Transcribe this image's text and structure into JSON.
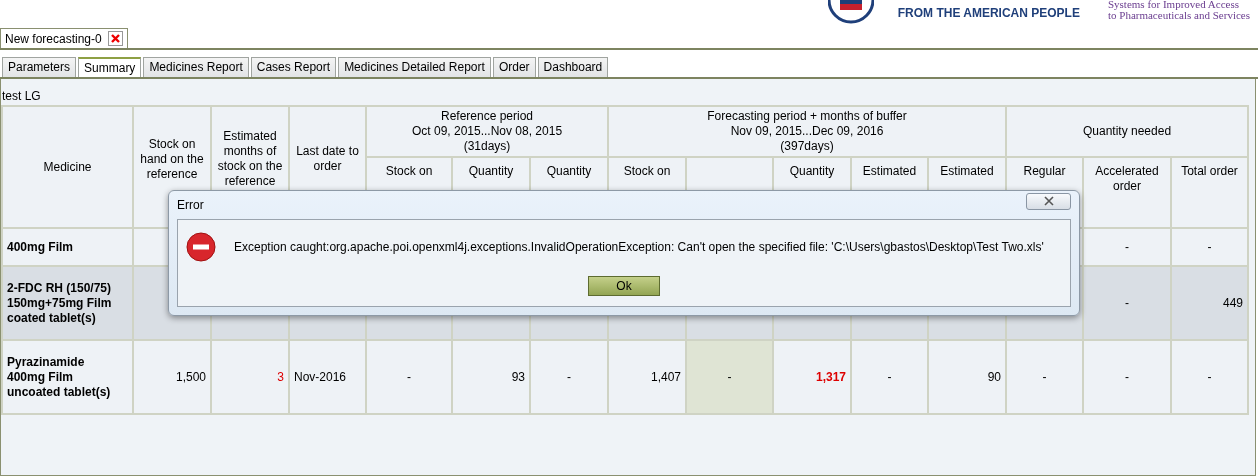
{
  "logo": {
    "tagline": "FROM THE AMERICAN PEOPLE",
    "program_lines": [
      "Systems for Improved Access",
      "to Pharmaceuticals and Services"
    ]
  },
  "document_tabs": [
    {
      "label": "New forecasting-0",
      "selected": true
    }
  ],
  "tabs": [
    {
      "label": "Parameters",
      "selected": false
    },
    {
      "label": "Summary",
      "selected": true
    },
    {
      "label": "Medicines Report",
      "selected": false
    },
    {
      "label": "Cases Report",
      "selected": false
    },
    {
      "label": "Medicines Detailed Report",
      "selected": false
    },
    {
      "label": "Order",
      "selected": false
    },
    {
      "label": "Dashboard",
      "selected": false
    }
  ],
  "report_title": "test LG",
  "table": {
    "columns": [
      {
        "label": "Medicine"
      },
      {
        "label": "Stock on hand on the reference"
      },
      {
        "label": "Estimated months of stock on the reference"
      },
      {
        "label": "Last date to order"
      },
      {
        "label": "Reference period\nOct 09, 2015...Nov 08, 2015\n(31days)",
        "colspan": 3,
        "children": [
          {
            "kind": "label",
            "label": "Stock on"
          },
          {
            "kind": "label",
            "label": "Quantity"
          },
          {
            "kind": "label",
            "label": "Quantity"
          }
        ]
      },
      {
        "label": "Forecasting period + months of buffer\nNov 09, 2015...Dec 09, 2016\n(397days)",
        "colspan": 5,
        "children": [
          {
            "kind": "label",
            "label": "Stock on"
          },
          {
            "kind": "blank"
          },
          {
            "kind": "label",
            "label": "Quantity"
          },
          {
            "kind": "label",
            "label": "Estimated"
          },
          {
            "kind": "label",
            "label": "Estimated"
          }
        ]
      },
      {
        "label": "Quantity needed",
        "colspan": 3,
        "children": [
          {
            "kind": "label",
            "label": "Regular"
          },
          {
            "kind": "label",
            "label": "Accelerated order"
          },
          {
            "kind": "label",
            "label": "Total order"
          }
        ]
      }
    ],
    "rows": [
      {
        "selected": false,
        "cells": [
          {
            "text": "400mg Film",
            "kind": "medicine"
          },
          "",
          "",
          "",
          "",
          "",
          "",
          "",
          "",
          "",
          "",
          "",
          "",
          {
            "text": "-",
            "kind": "dash"
          },
          {
            "text": "-",
            "kind": "dash"
          }
        ]
      },
      {
        "selected": true,
        "cells": [
          {
            "text": "2-FDC RH (150/75) 150mg+75mg Film coated tablet(s)",
            "kind": "medicine"
          },
          "",
          "",
          "",
          "",
          "",
          "",
          "",
          "",
          "",
          "",
          "",
          "",
          {
            "text": "-",
            "kind": "dash"
          },
          {
            "text": "449",
            "kind": "number"
          }
        ]
      },
      {
        "selected": false,
        "cells": [
          {
            "text": "Pyrazinamide 400mg Film uncoated tablet(s)",
            "kind": "medicine"
          },
          {
            "text": "1,500",
            "kind": "number"
          },
          {
            "text": "3",
            "kind": "number",
            "color": "#dd0000"
          },
          {
            "text": "Nov-2016",
            "kind": "date"
          },
          {
            "text": "-",
            "kind": "dash"
          },
          {
            "text": "93",
            "kind": "number"
          },
          {
            "text": "-",
            "kind": "dash"
          },
          {
            "text": "1,407",
            "kind": "number"
          },
          {
            "text": "-",
            "kind": "dash",
            "shaded": true
          },
          {
            "text": "1,317",
            "kind": "number",
            "color": "#dd0000",
            "bold": true
          },
          {
            "text": "-",
            "kind": "dash"
          },
          {
            "text": "90",
            "kind": "number"
          },
          {
            "text": "-",
            "kind": "dash"
          },
          {
            "text": "-",
            "kind": "dash"
          },
          {
            "text": "-",
            "kind": "dash"
          }
        ]
      }
    ]
  },
  "dialog": {
    "title": "Error",
    "message": "Exception caught:org.apache.poi.openxml4j.exceptions.InvalidOperationException: Can't open the specified file: 'C:\\Users\\gbastos\\Desktop\\Test Two.xls'",
    "button": "Ok"
  }
}
